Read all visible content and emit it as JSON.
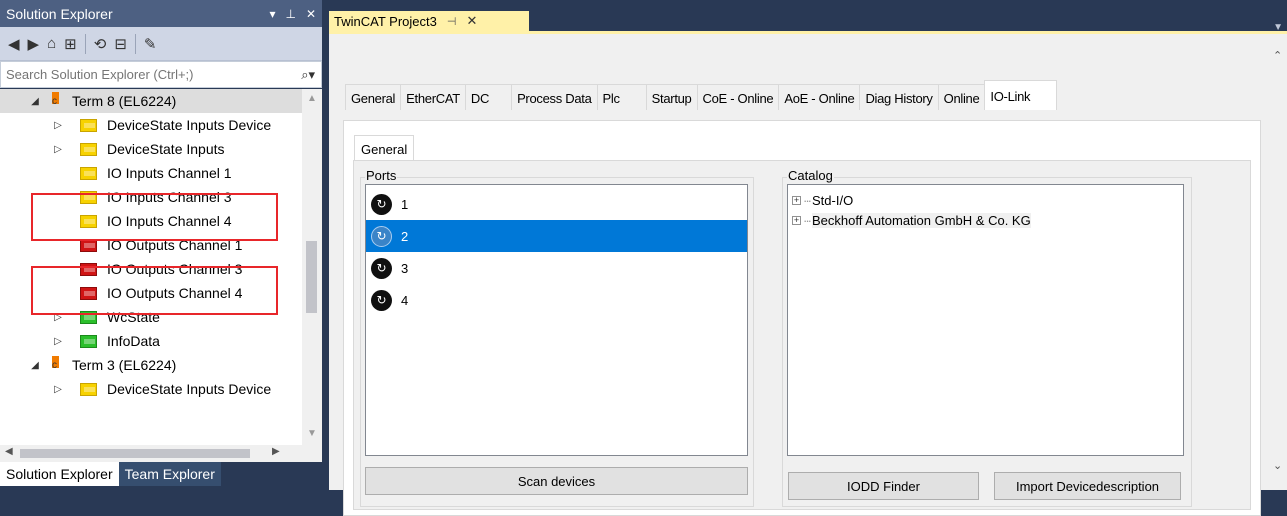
{
  "solution_explorer": {
    "title": "Solution Explorer",
    "title_buttons": [
      "▾",
      "⊥",
      "✕"
    ],
    "search_placeholder": "Search Solution Explorer (Ctrl+;)",
    "tree": [
      {
        "label": "Term 8 (EL6224)",
        "expander": "◢",
        "icon": "terminal-icon"
      },
      {
        "label": "DeviceState Inputs Device",
        "expander": "▷",
        "icon": "input-folder-icon"
      },
      {
        "label": "DeviceState Inputs",
        "expander": "▷",
        "icon": "input-folder-icon"
      },
      {
        "label": "IO Inputs Channel 1",
        "expander": "",
        "icon": "input-folder-icon"
      },
      {
        "label": "IO Inputs Channel 3",
        "expander": "",
        "icon": "input-folder-icon"
      },
      {
        "label": "IO Inputs Channel 4",
        "expander": "",
        "icon": "input-folder-icon"
      },
      {
        "label": "IO Outputs Channel 1",
        "expander": "",
        "icon": "output-folder-icon"
      },
      {
        "label": "IO Outputs Channel 3",
        "expander": "",
        "icon": "output-folder-icon"
      },
      {
        "label": "IO Outputs Channel 4",
        "expander": "",
        "icon": "output-folder-icon"
      },
      {
        "label": "WcState",
        "expander": "▷",
        "icon": "status-folder-icon"
      },
      {
        "label": "InfoData",
        "expander": "▷",
        "icon": "status-folder-icon"
      },
      {
        "label": "Term 3 (EL6224)",
        "expander": "◢",
        "icon": "terminal-icon"
      },
      {
        "label": "DeviceState Inputs Device",
        "expander": "▷",
        "icon": "input-folder-icon"
      }
    ],
    "bottom_tabs": [
      "Solution Explorer",
      "Team Explorer"
    ]
  },
  "document": {
    "tab_title": "TwinCAT Project3",
    "tab_pin": "⊣",
    "tab_close": "✕",
    "tabs": [
      "General",
      "EtherCAT",
      "DC",
      "Process Data",
      "Plc",
      "Startup",
      "CoE - Online",
      "AoE - Online",
      "Diag History",
      "Online",
      "IO-Link"
    ],
    "active_tab": "IO-Link",
    "sub_tab": "General",
    "ports_label": "Ports",
    "ports": [
      "1",
      "2",
      "3",
      "4"
    ],
    "selected_port": "2",
    "catalog_label": "Catalog",
    "catalog": [
      "Std-I/O",
      "Beckhoff Automation GmbH & Co. KG"
    ],
    "buttons": {
      "scan": "Scan devices",
      "iodd": "IODD Finder",
      "import": "Import Devicedescription"
    }
  },
  "colors": {
    "chrome": "#293955",
    "doc_tab": "#fff1a8",
    "selection": "#0078d7",
    "highlight_box": "#e8262a"
  }
}
